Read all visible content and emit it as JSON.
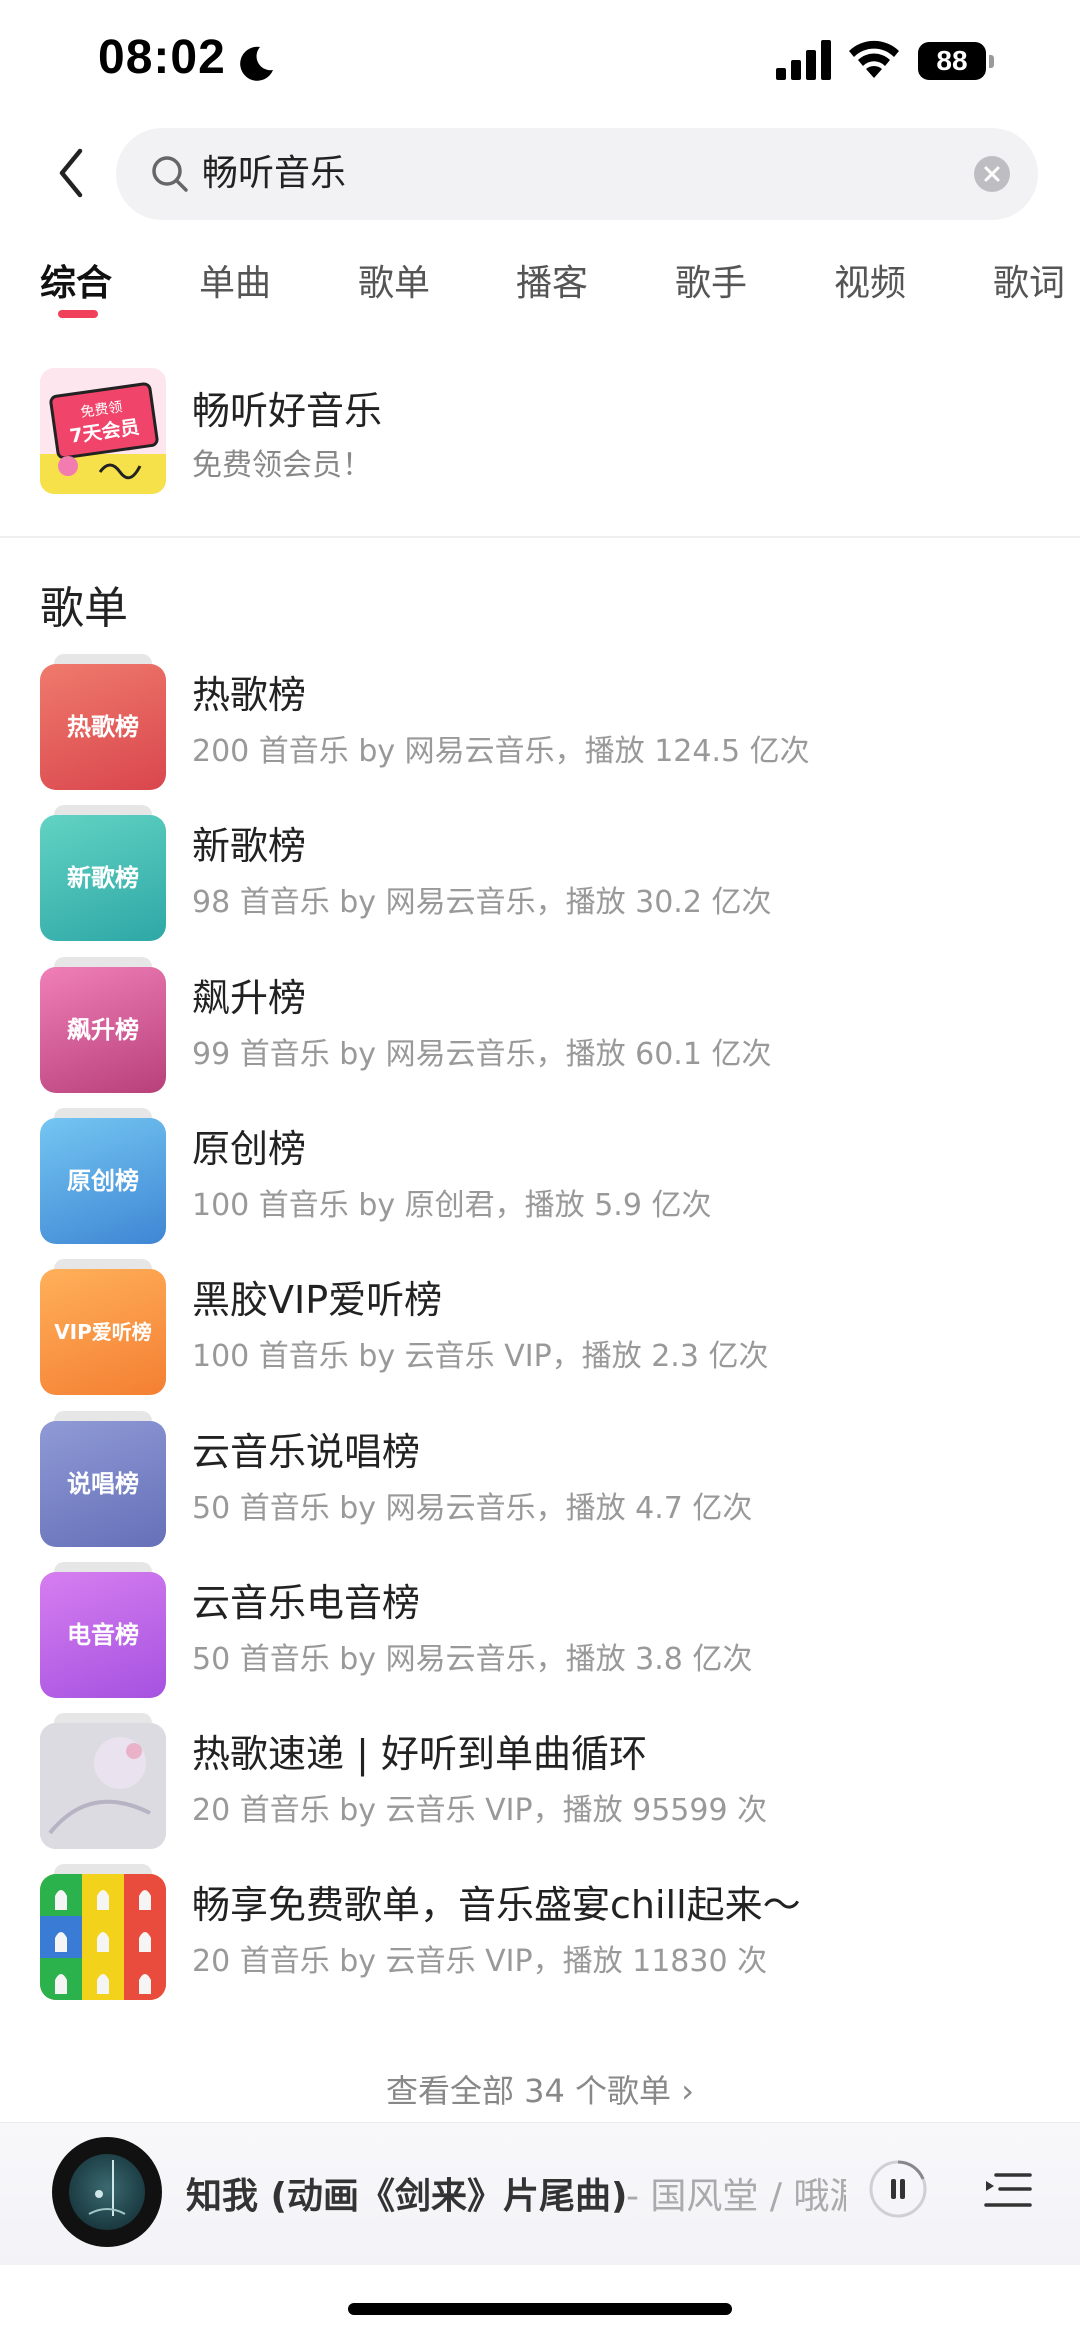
{
  "status": {
    "time": "08:02",
    "battery": "88"
  },
  "search": {
    "query": "畅听音乐"
  },
  "tabs": [
    "综合",
    "单曲",
    "歌单",
    "播客",
    "歌手",
    "视频",
    "歌词"
  ],
  "promo": {
    "title": "畅听好音乐",
    "subtitle": "免费领会员！",
    "badge_top": "免费领",
    "badge_main": "7天会员"
  },
  "section": {
    "title": "歌单"
  },
  "playlists": [
    {
      "title": "热歌榜",
      "meta": "200 首音乐   by 网易云音乐，播放 124.5 亿次",
      "cover_label": "热歌榜",
      "color_a": "#ef7a6c",
      "color_b": "#d9464d"
    },
    {
      "title": "新歌榜",
      "meta": "98 首音乐   by 网易云音乐，播放 30.2 亿次",
      "cover_label": "新歌榜",
      "color_a": "#62d3c3",
      "color_b": "#2ea7a6"
    },
    {
      "title": "飙升榜",
      "meta": "99 首音乐   by 网易云音乐，播放 60.1 亿次",
      "cover_label": "飙升榜",
      "color_a": "#f07fb8",
      "color_b": "#b8407a"
    },
    {
      "title": "原创榜",
      "meta": "100 首音乐   by 原创君，播放 5.9 亿次",
      "cover_label": "原创榜",
      "color_a": "#74c6f2",
      "color_b": "#3f86d4"
    },
    {
      "title": "黑胶VIP爱听榜",
      "meta": "100 首音乐   by 云音乐 VIP，播放 2.3 亿次",
      "cover_label": "VIP爱听榜",
      "color_a": "#ffb05a",
      "color_b": "#f47f33"
    },
    {
      "title": "云音乐说唱榜",
      "meta": "50 首音乐   by 网易云音乐，播放 4.7 亿次",
      "cover_label": "说唱榜",
      "color_a": "#8f9ad6",
      "color_b": "#6570b8"
    },
    {
      "title": "云音乐电音榜",
      "meta": "50 首音乐   by 网易云音乐，播放 3.8 亿次",
      "cover_label": "电音榜",
      "color_a": "#d67ef0",
      "color_b": "#a552e0"
    },
    {
      "title": "热歌速递 | 好听到单曲循环",
      "meta": "20 首音乐   by 云音乐 VIP，播放 95599 次",
      "cover_label": "",
      "color_a": "#d9d9df",
      "color_b": "#c2bfcd"
    },
    {
      "title": "畅享免费歌单，音乐盛宴chill起来～",
      "meta": "20 首音乐   by 云音乐 VIP，播放 11830 次",
      "cover_label": "",
      "color_a": "#f1d324",
      "color_b": "#e0403c"
    }
  ],
  "view_all": "查看全部 34 个歌单  ›",
  "player": {
    "song": "知我 (动画《剑来》片尾曲)",
    "artist": "- 国风堂 / 哦漏"
  },
  "colors": {
    "accent": "#f0405a"
  }
}
